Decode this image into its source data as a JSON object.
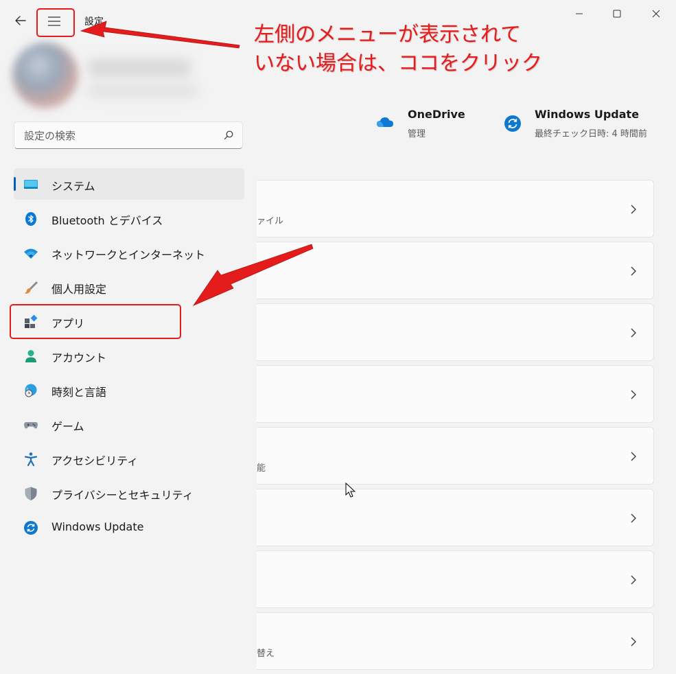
{
  "window": {
    "title": "設定",
    "back_icon": "back-arrow-icon",
    "menu_icon": "hamburger-menu-icon"
  },
  "search": {
    "placeholder": "設定の検索",
    "icon": "search-icon"
  },
  "nav": {
    "items": [
      {
        "label": "システム",
        "icon": "system-icon",
        "selected": true
      },
      {
        "label": "Bluetooth とデバイス",
        "icon": "bluetooth-icon"
      },
      {
        "label": "ネットワークとインターネット",
        "icon": "wifi-icon"
      },
      {
        "label": "個人用設定",
        "icon": "paintbrush-icon"
      },
      {
        "label": "アプリ",
        "icon": "apps-icon"
      },
      {
        "label": "アカウント",
        "icon": "account-icon"
      },
      {
        "label": "時刻と言語",
        "icon": "time-language-icon"
      },
      {
        "label": "ゲーム",
        "icon": "gamepad-icon"
      },
      {
        "label": "アクセシビリティ",
        "icon": "accessibility-icon"
      },
      {
        "label": "プライバシーとセキュリティ",
        "icon": "shield-icon"
      },
      {
        "label": "Windows Update",
        "icon": "windows-update-icon"
      }
    ]
  },
  "quick": {
    "onedrive": {
      "title": "OneDrive",
      "subtitle": "管理",
      "icon": "onedrive-cloud-icon"
    },
    "update": {
      "title": "Windows Update",
      "subtitle": "最終チェック日時: 4 時間前",
      "icon": "windows-update-icon"
    }
  },
  "cards": [
    {
      "subtitle": "ァイル"
    },
    {
      "subtitle": ""
    },
    {
      "subtitle": ""
    },
    {
      "subtitle": ""
    },
    {
      "subtitle": "能"
    },
    {
      "subtitle": ""
    },
    {
      "subtitle": ""
    },
    {
      "subtitle": "替え"
    }
  ],
  "annotation": {
    "line1": "左側のメニューが表示されて",
    "line2": "いない場合は、ココをクリック"
  },
  "colors": {
    "accent": "#005fb8",
    "annotation": "#e41c1c",
    "background": "#f3f3f3"
  }
}
